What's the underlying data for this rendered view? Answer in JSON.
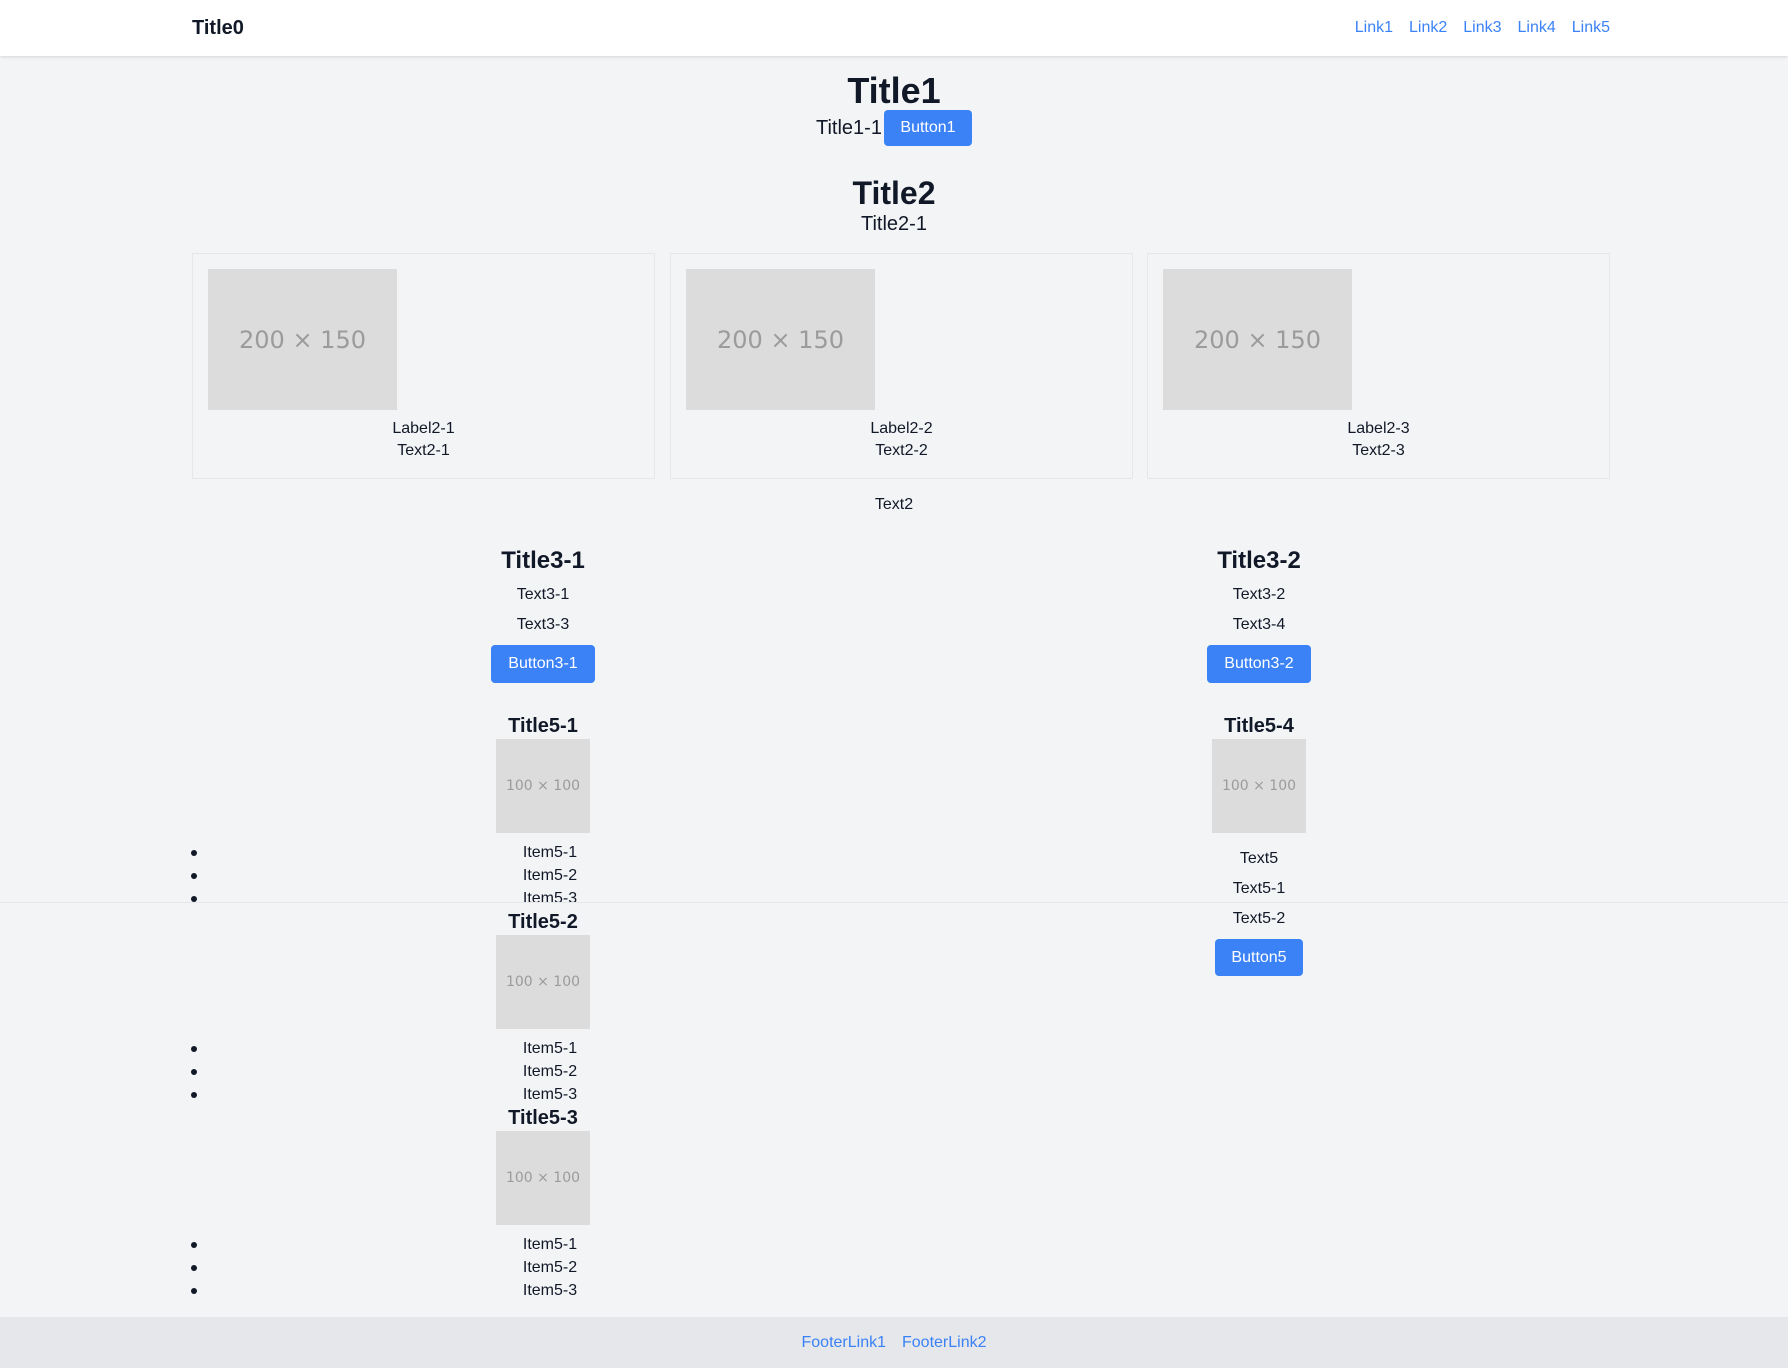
{
  "header": {
    "title": "Title0",
    "links": [
      "Link1",
      "Link2",
      "Link3",
      "Link4",
      "Link5"
    ]
  },
  "hero": {
    "title": "Title1",
    "subtitle": "Title1-1",
    "button": "Button1"
  },
  "section2": {
    "title": "Title2",
    "subtitle": "Title2-1",
    "cards": [
      {
        "image": "200 × 150",
        "label": "Label2-1",
        "text": "Text2-1"
      },
      {
        "image": "200 × 150",
        "label": "Label2-2",
        "text": "Text2-2"
      },
      {
        "image": "200 × 150",
        "label": "Label2-3",
        "text": "Text2-3"
      }
    ],
    "footer_text": "Text2"
  },
  "section3": {
    "left": {
      "title": "Title3-1",
      "texts": [
        "Text3-1",
        "Text3-3"
      ],
      "button": "Button3-1"
    },
    "right": {
      "title": "Title3-2",
      "texts": [
        "Text3-2",
        "Text3-4"
      ],
      "button": "Button3-2"
    }
  },
  "section5": {
    "left_blocks": [
      {
        "title": "Title5-1",
        "image": "100 × 100",
        "items": [
          "Item5-1",
          "Item5-2",
          "Item5-3"
        ]
      },
      {
        "title": "Title5-2",
        "image": "100 × 100",
        "items": [
          "Item5-1",
          "Item5-2",
          "Item5-3"
        ]
      },
      {
        "title": "Title5-3",
        "image": "100 × 100",
        "items": [
          "Item5-1",
          "Item5-2",
          "Item5-3"
        ]
      }
    ],
    "right": {
      "title": "Title5-4",
      "image": "100 × 100",
      "texts": [
        "Text5",
        "Text5-1",
        "Text5-2"
      ],
      "button": "Button5"
    }
  },
  "footer": {
    "links": [
      "FooterLink1",
      "FooterLink2"
    ]
  },
  "colors": {
    "accent": "#3b82f6",
    "background": "#f3f4f6",
    "header_bg": "#ffffff",
    "footer_bg": "#e5e7eb",
    "placeholder": "#dcdcdc"
  }
}
